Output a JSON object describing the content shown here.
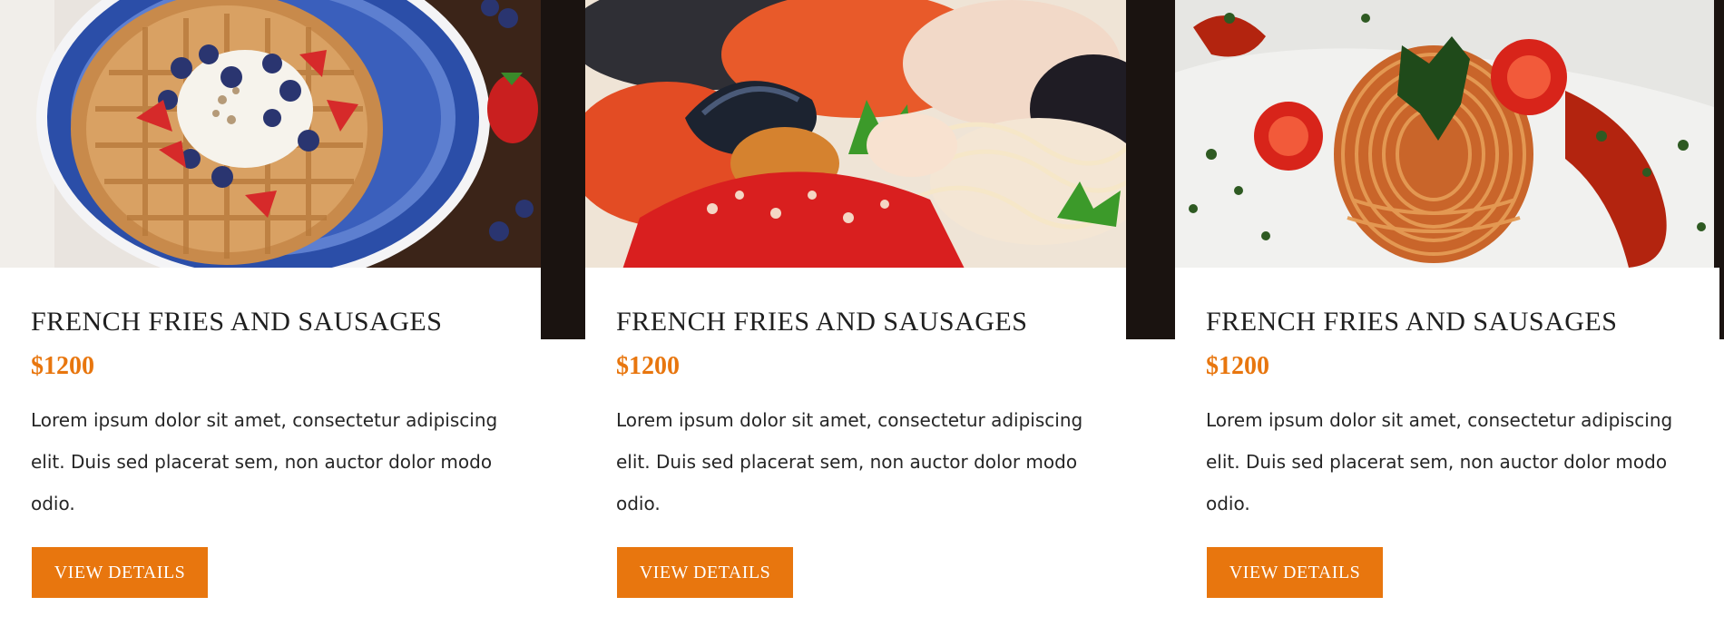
{
  "colors": {
    "accent": "#e8760e",
    "title": "#1f1f1f",
    "text": "#262626",
    "dark_band": "#1a1310"
  },
  "cards": [
    {
      "image_icon": "waffle-with-berries-image",
      "title": "FRENCH FRIES AND SAUSAGES",
      "price": "$1200",
      "description": "Lorem ipsum dolor sit amet, consectetur adipiscing elit. Duis sed placerat sem, non auctor dolor modo odio.",
      "button_label": "VIEW DETAILS"
    },
    {
      "image_icon": "seafood-pasta-image",
      "title": "FRENCH FRIES AND SAUSAGES",
      "price": "$1200",
      "description": "Lorem ipsum dolor sit amet, consectetur adipiscing elit. Duis sed placerat sem, non auctor dolor modo odio.",
      "button_label": "VIEW DETAILS"
    },
    {
      "image_icon": "spaghetti-with-tomatoes-image",
      "title": "FRENCH FRIES AND SAUSAGES",
      "price": "$1200",
      "description": "Lorem ipsum dolor sit amet, consectetur adipiscing elit. Duis sed placerat sem, non auctor dolor modo odio.",
      "button_label": "VIEW DETAILS"
    }
  ]
}
